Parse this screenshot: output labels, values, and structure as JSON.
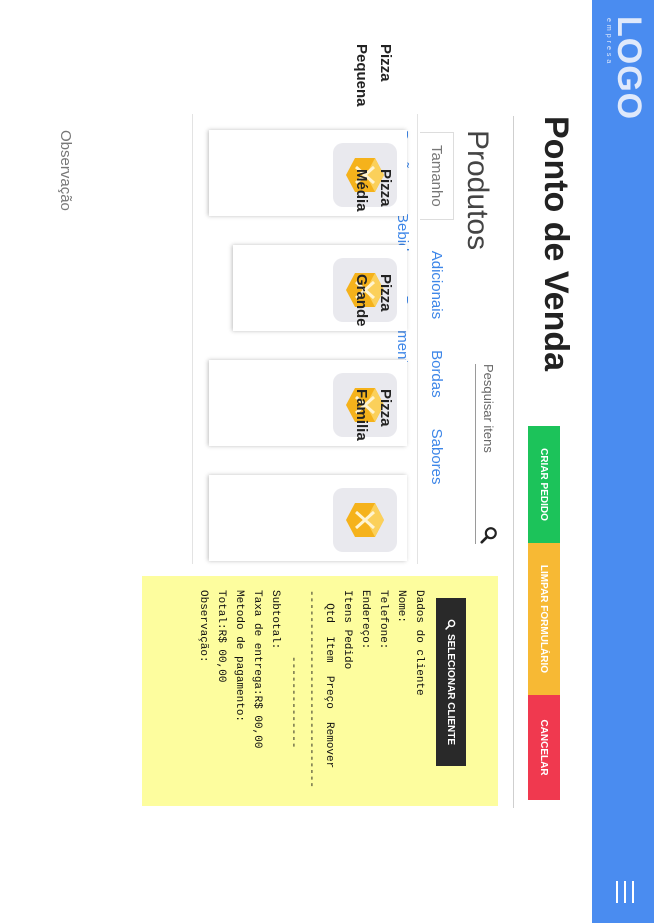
{
  "app": {
    "logo_main": "LOGO",
    "logo_sub": "empresa",
    "page_title": "Ponto de Venda"
  },
  "actions": {
    "criar_pedido": "CRIAR PEDIDO",
    "limpar_formulario": "LIMPAR FORMULÁRIO",
    "cancelar": "CANCELAR"
  },
  "products_panel": {
    "title": "Produtos",
    "search_placeholder": "Pesquisar itens",
    "tabs_row1": [
      "Tamanho",
      "Adicionais",
      "Bordas",
      "Sabores"
    ],
    "tabs_row2": [
      "Porções",
      "Bebidas",
      "Pagamento"
    ],
    "active_tab": "Tamanho",
    "items": [
      {
        "name": "Pizza Pequena"
      },
      {
        "name": "Pizza Média"
      },
      {
        "name": "Pizza Grande"
      },
      {
        "name": "Pizza Familia"
      }
    ],
    "observation_label": "Observação"
  },
  "receipt": {
    "select_client": "SELECIONAR CLIENTE",
    "lines": [
      "Dados do cliente",
      "Nome:",
      "Telefone:",
      "Endereço:",
      "",
      "Itens Pedido",
      "",
      "  Qtd  Item  Preço  Remover",
      "",
      "------------------------------",
      "",
      "          --------------",
      "Subtotal:",
      "Taxa de entrega:R$ 00,00",
      "Metodo de pagamento:",
      "",
      "Total:R$ 00,00",
      "",
      "Observação:"
    ]
  },
  "colors": {
    "appbar": "#4a8cf0",
    "green": "#1cc35a",
    "orange": "#f7b934",
    "red": "#f0394f",
    "receipt_bg": "#fdfd9e",
    "tab_link": "#3d86e8"
  }
}
